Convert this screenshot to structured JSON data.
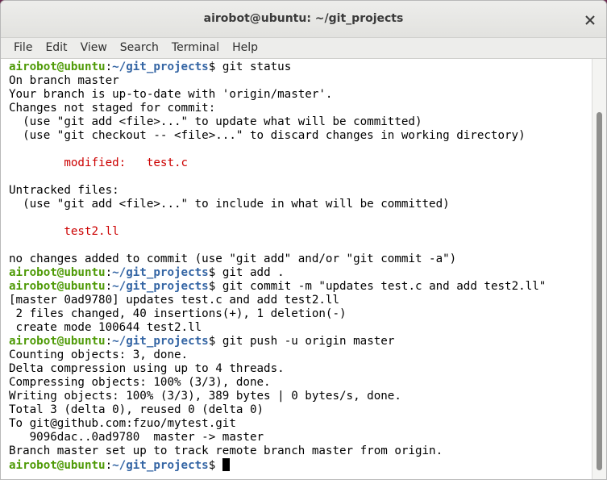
{
  "window": {
    "title": "airobot@ubuntu: ~/git_projects"
  },
  "menu": [
    "File",
    "Edit",
    "View",
    "Search",
    "Terminal",
    "Help"
  ],
  "prompt": {
    "user": "airobot@ubuntu",
    "colon": ":",
    "path": "~/git_projects",
    "symbol": "$ "
  },
  "terminal": {
    "cmd1": "git status",
    "out_on_branch": "On branch master",
    "out_uptodate": "Your branch is up-to-date with 'origin/master'.",
    "out_changes": "Changes not staged for commit:",
    "out_hint_add": "  (use \"git add <file>...\" to update what will be committed)",
    "out_hint_checkout": "  (use \"git checkout -- <file>...\" to discard changes in working directory)",
    "out_modified_indent": "        ",
    "out_modified": "modified:   test.c",
    "out_untracked": "Untracked files:",
    "out_hint_include": "  (use \"git add <file>...\" to include in what will be committed)",
    "out_untracked_file": "test2.ll",
    "out_no_changes": "no changes added to commit (use \"git add\" and/or \"git commit -a\")",
    "cmd2": "git add .",
    "cmd3": "git commit -m \"updates test.c and add test2.ll\"",
    "out_commit": "[master 0ad9780] updates test.c and add test2.ll",
    "out_files_changed": " 2 files changed, 40 insertions(+), 1 deletion(-)",
    "out_create_mode": " create mode 100644 test2.ll",
    "cmd4": "git push -u origin master",
    "out_counting": "Counting objects: 3, done.",
    "out_delta": "Delta compression using up to 4 threads.",
    "out_compressing": "Compressing objects: 100% (3/3), done.",
    "out_writing": "Writing objects: 100% (3/3), 389 bytes | 0 bytes/s, done.",
    "out_total": "Total 3 (delta 0), reused 0 (delta 0)",
    "out_to": "To git@github.com:fzuo/mytest.git",
    "out_range": "   9096dac..0ad9780  master -> master",
    "out_tracking": "Branch master set up to track remote branch master from origin."
  },
  "icons": {
    "close": "close-icon"
  },
  "colors": {
    "prompt_user": "#4e9a06",
    "prompt_path": "#3465a4",
    "git_status_red": "#cc0000"
  }
}
